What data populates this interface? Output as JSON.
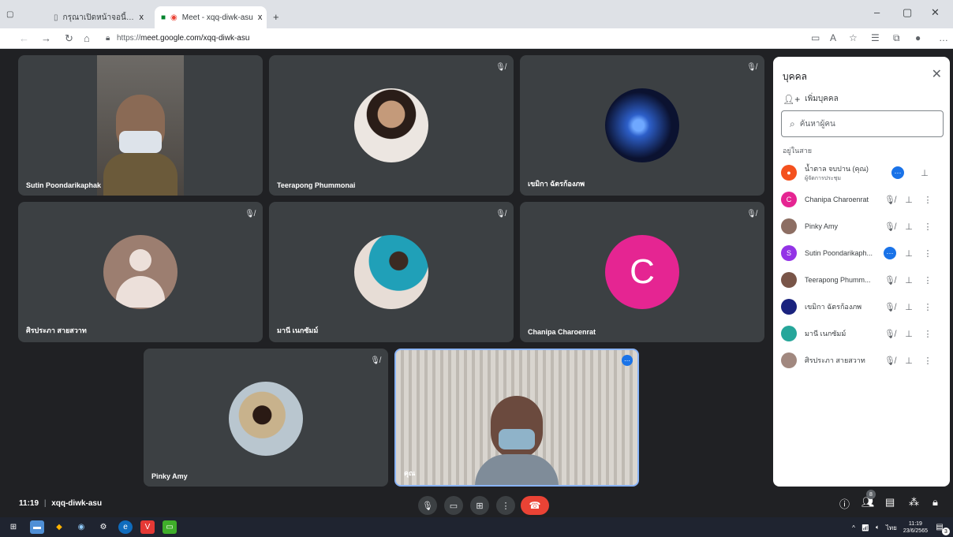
{
  "browser": {
    "tab_inactive_title": "กรุณาเปิดหน้าจอนี้ก่อนใช้งาน Inte",
    "tab_active_title": "Meet - xqq-diwk-asu",
    "new_tab": "+",
    "tab_close": "x",
    "url_prefix": "https://",
    "url_host": "meet.google.com/xqq-diwk-asu"
  },
  "tiles": [
    {
      "name": "Sutin Poondarikaphak"
    },
    {
      "name": "Teerapong Phummonai"
    },
    {
      "name": "เขมิกา ฉัตรก้องภพ"
    },
    {
      "name": "ศิรประภา สายสวาท"
    },
    {
      "name": "มานี เนกซัมม์"
    },
    {
      "name": "Chanipa Charoenrat",
      "letter": "C"
    },
    {
      "name": "Pinky Amy"
    },
    {
      "name": "คุณ"
    }
  ],
  "people": {
    "title": "บุคคล",
    "add_label": "เพิ่มบุคคล",
    "search_placeholder": "ค้นหาผู้คน",
    "section_label": "อยู่ในสาย",
    "list": [
      {
        "name": "น้ำตาล จบปาน (คุณ)",
        "sub": "ผู้จัดการประชุม",
        "color": "#f4511e"
      },
      {
        "name": "Chanipa Charoenrat",
        "letter": "C",
        "color": "#e52592"
      },
      {
        "name": "Pinky Amy",
        "color": "#8d6e63"
      },
      {
        "name": "Sutin Poondarikaph...",
        "letter": "S",
        "color": "#9334e6"
      },
      {
        "name": "Teerapong Phumm...",
        "color": "#795548"
      },
      {
        "name": "เขมิกา ฉัตรก้องภพ",
        "color": "#1a237e"
      },
      {
        "name": "มานี เนกซัมม์",
        "color": "#26a69a"
      },
      {
        "name": "ศิรประภา สายสวาท",
        "color": "#a1887f"
      }
    ]
  },
  "bottom": {
    "time": "11:19",
    "meeting_code": "xqq-diwk-asu",
    "participant_count": "8"
  },
  "taskbar": {
    "time": "11:19",
    "date": "23/6/2565",
    "lang": "ไทย",
    "notif": "3"
  },
  "colors": {
    "meet_bg": "#202124",
    "tile_bg": "#3c4043",
    "end_call": "#ea4335",
    "accent": "#1a73e8"
  }
}
